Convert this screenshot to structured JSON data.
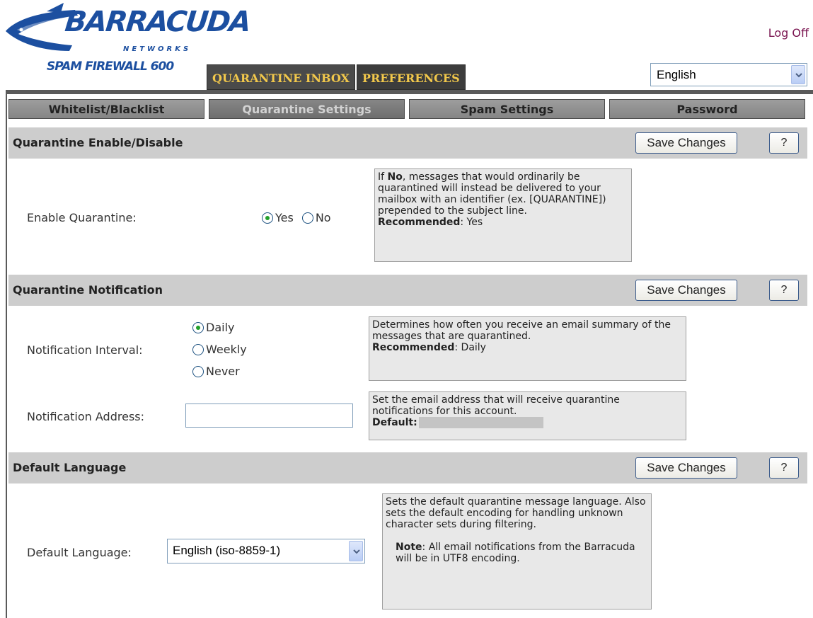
{
  "header": {
    "logo": {
      "wordmark": "BARRACUDA",
      "networks": "NETWORKS",
      "product": "SPAM FIREWALL 600",
      "brand_color": "#1c4fa0"
    },
    "logoff_label": "Log Off",
    "main_tabs": [
      {
        "label": "QUARANTINE INBOX",
        "active": false
      },
      {
        "label": "PREFERENCES",
        "active": true
      }
    ],
    "language_select": {
      "value": "English"
    }
  },
  "subtabs": [
    {
      "label": "Whitelist/Blacklist",
      "active": false
    },
    {
      "label": "Quarantine Settings",
      "active": true
    },
    {
      "label": "Spam Settings",
      "active": false
    },
    {
      "label": "Password",
      "active": false
    }
  ],
  "sections": {
    "enable": {
      "title": "Quarantine Enable/Disable",
      "save_label": "Save Changes",
      "help_label": "?",
      "field_label": "Enable Quarantine:",
      "options": [
        {
          "label": "Yes",
          "checked": true
        },
        {
          "label": "No",
          "checked": false
        }
      ],
      "help": {
        "pre": "If ",
        "bold": "No",
        "text": ", messages that would ordinarily be quarantined will instead be delivered to your mailbox with an identifier (ex. [QUARANTINE]) prepended to the subject line.",
        "rec_label": "Recommended",
        "rec_value": ": Yes"
      }
    },
    "notification": {
      "title": "Quarantine Notification",
      "save_label": "Save Changes",
      "help_label": "?",
      "interval_label": "Notification Interval:",
      "interval_options": [
        {
          "label": "Daily",
          "checked": true
        },
        {
          "label": "Weekly",
          "checked": false
        },
        {
          "label": "Never",
          "checked": false
        }
      ],
      "interval_help": {
        "text": "Determines how often you receive an email summary of the messages that are quarantined.",
        "rec_label": "Recommended",
        "rec_value": ": Daily"
      },
      "address_label": "Notification Address:",
      "address_value": "",
      "address_help": {
        "text": "Set the email address that will receive quarantine notifications for this account.",
        "default_label": "Default:"
      }
    },
    "language": {
      "title": "Default Language",
      "save_label": "Save Changes",
      "help_label": "?",
      "field_label": "Default Language:",
      "select_value": "English (iso-8859-1)",
      "help": {
        "text": "Sets the default quarantine message language. Also sets the default encoding for handling unknown character sets during filtering.",
        "note_label": "Note",
        "note_text": ": All email notifications from the Barracuda will be in UTF8 encoding."
      }
    }
  }
}
